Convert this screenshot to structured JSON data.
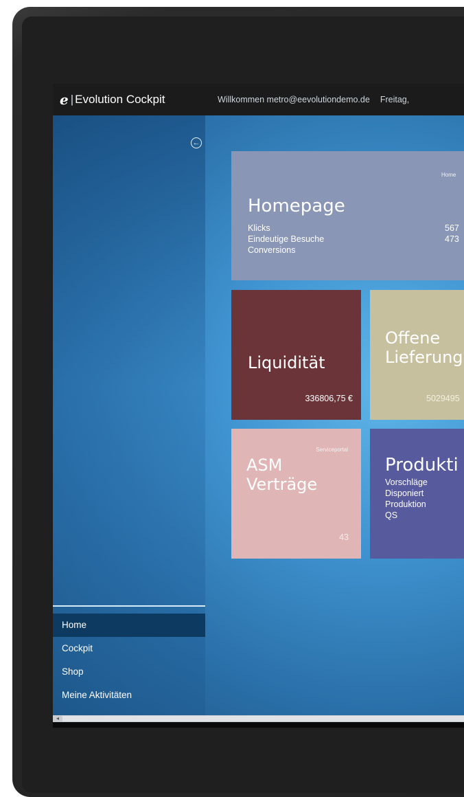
{
  "header": {
    "logo_mark": "e",
    "logo_sep": "|",
    "app_name": "Evolution Cockpit",
    "welcome": "Willkommen metro@eevolutiondemo.de",
    "date": "Freitag,"
  },
  "sidebar": {
    "items": [
      {
        "label": "Home",
        "active": true
      },
      {
        "label": "Cockpit"
      },
      {
        "label": "Shop"
      },
      {
        "label": "Meine Aktivitäten"
      }
    ]
  },
  "tiles": {
    "homepage": {
      "caption": "Home",
      "title": "Homepage",
      "rows": [
        "Klicks",
        "Eindeutige Besuche",
        "Conversions"
      ],
      "values": [
        "567",
        "473"
      ],
      "color": "#8996b5"
    },
    "liquiditaet": {
      "title": "Liquidität",
      "value": "336806,75 €",
      "color": "#6b3438"
    },
    "offene": {
      "title_line1": "Offene",
      "title_line2": "Lieferung",
      "value": "5029495",
      "color": "#c7c09f"
    },
    "asm": {
      "caption": "Serviceportal",
      "title_line1": "ASM",
      "title_line2": "Verträge",
      "value": "43",
      "color": "#e0b5b5"
    },
    "produktion": {
      "title": "Produkti",
      "rows": [
        "Vorschläge",
        "Disponiert",
        "Produktion",
        "QS"
      ],
      "color": "#575b9e"
    }
  },
  "scrollbar": {
    "left_arrow": "◂"
  },
  "icons": {
    "back": "back-arrow-icon"
  }
}
